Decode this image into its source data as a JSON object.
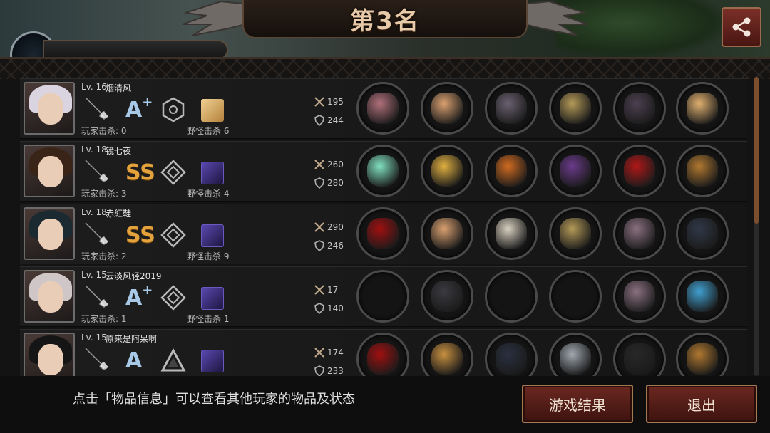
{
  "header": {
    "title": "第3名",
    "share_icon": "share-icon"
  },
  "players": [
    {
      "level": "Lv. 16",
      "name": "烟清风",
      "player_kills": "玩家击杀: 0",
      "monster_kills": "野怪击杀 6",
      "grade": "A",
      "grade_plus": "+",
      "attack": "195",
      "defense": "244",
      "skill_color": "gold",
      "items": [
        "chain-blade",
        "winged-circlet",
        "plate-armor",
        "thorn-bracelet",
        "spiked-gauntlet",
        "portrait-charm"
      ]
    },
    {
      "level": "Lv. 18",
      "name": "镜七夜",
      "player_kills": "玩家击杀: 3",
      "monster_kills": "野怪击杀 4",
      "grade": "SS",
      "grade_plus": "",
      "attack": "260",
      "defense": "280",
      "skill_color": "purple",
      "items": [
        "twin-lightsabers",
        "royal-crown",
        "flame-armor",
        "violet-gauntlet",
        "red-heels",
        "treasure-box"
      ]
    },
    {
      "level": "Lv. 18",
      "name": "赤紅鞋",
      "player_kills": "玩家击杀: 2",
      "monster_kills": "野怪击杀 9",
      "grade": "SS",
      "grade_plus": "",
      "attack": "290",
      "defense": "246",
      "skill_color": "purple",
      "items": [
        "red-ribbon-blade",
        "winged-circlet",
        "white-armor",
        "thorn-bracelet",
        "leather-boots",
        "black-flag"
      ]
    },
    {
      "level": "Lv. 15",
      "name": "云淡风轻2019",
      "player_kills": "玩家击杀: 1",
      "monster_kills": "野怪击杀 1",
      "grade": "A",
      "grade_plus": "+",
      "attack": "17",
      "defense": "140",
      "skill_color": "purple",
      "items": [
        "",
        "knight-helmet",
        "",
        "",
        "leather-boots",
        "sapphire-ring"
      ]
    },
    {
      "level": "Lv. 15",
      "name": "原来是阿呆啊",
      "player_kills": "",
      "monster_kills": "",
      "grade": "A",
      "grade_plus": "",
      "attack": "174",
      "defense": "233",
      "skill_color": "purple",
      "items": [
        "red-ribbon-blade",
        "golden-helmet",
        "dark-armor",
        "steel-bracer",
        "black-boots",
        "treasure-box"
      ]
    }
  ],
  "footer": {
    "hint": "点击「物品信息」可以查看其他玩家的物品及状态",
    "result_button": "游戏结果",
    "exit_button": "退出"
  }
}
